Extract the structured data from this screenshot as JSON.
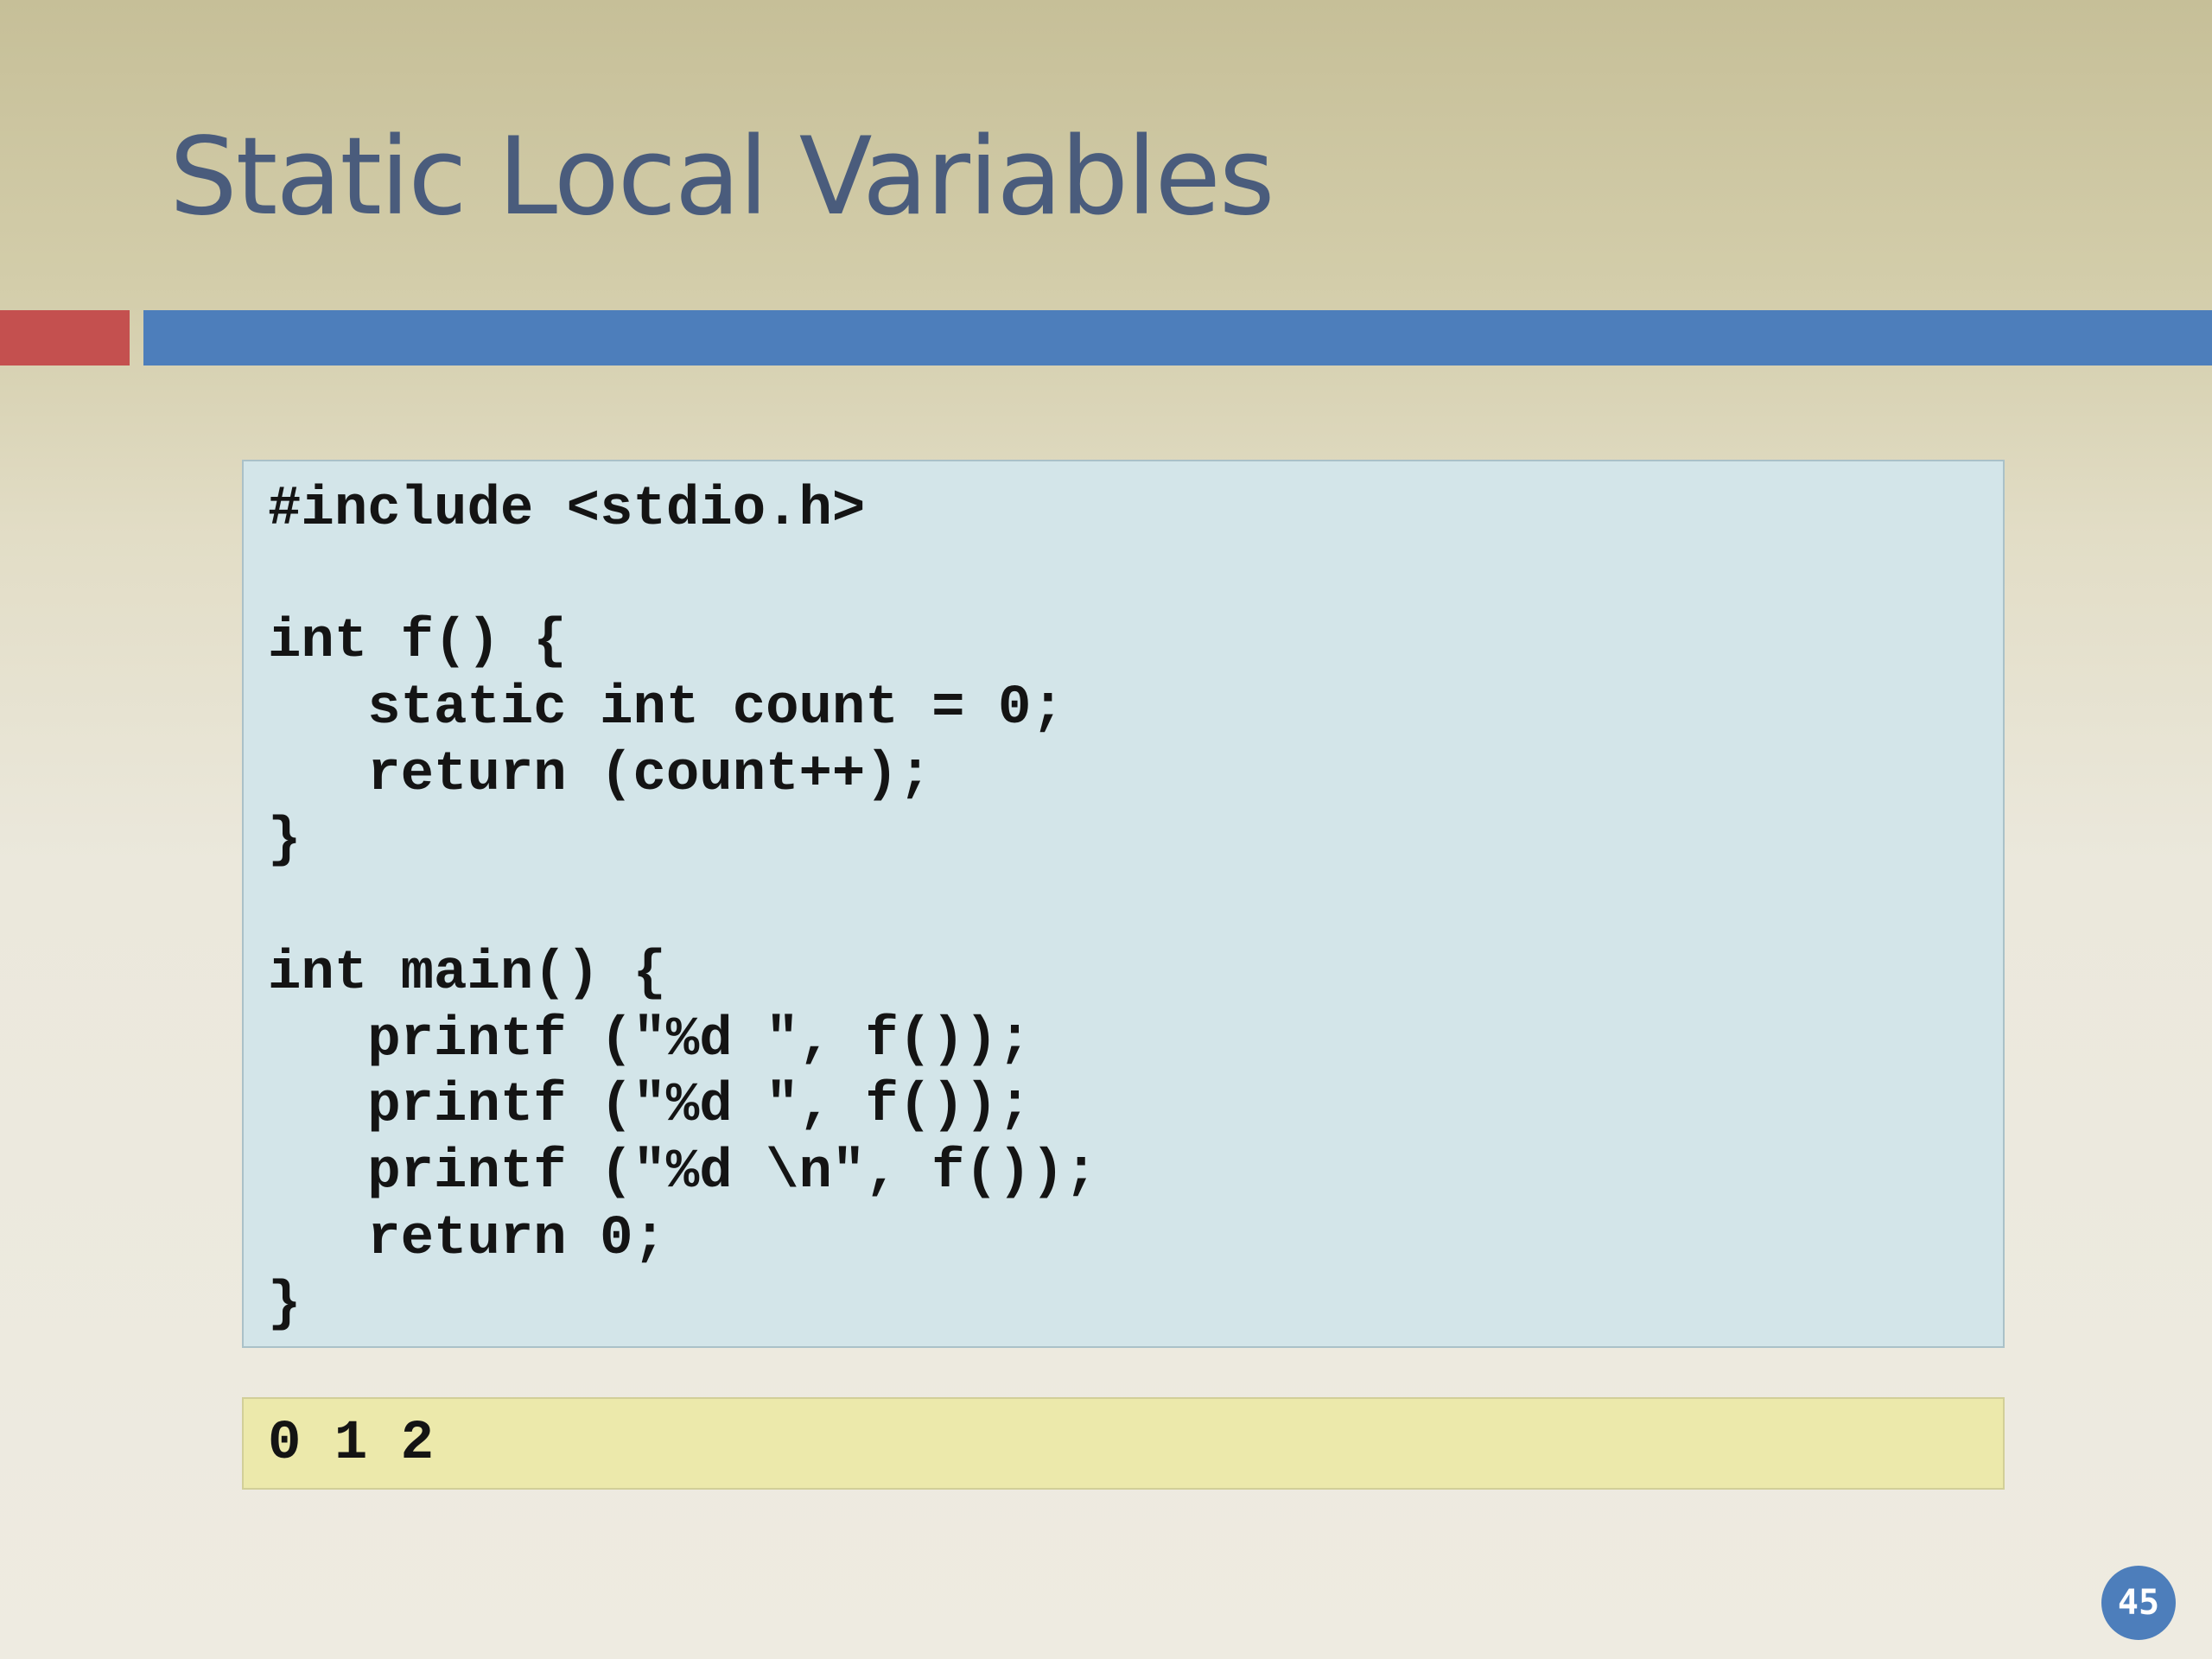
{
  "slide": {
    "title": "Static Local Variables",
    "code_lines": [
      "#include <stdio.h>",
      "",
      "int f() {",
      "   static int count = 0;",
      "   return (count++);",
      "}",
      "",
      "int main() {",
      "   printf (\"%d \", f());",
      "   printf (\"%d \", f());",
      "   printf (\"%d \\n\", f());",
      "   return 0;",
      "}"
    ],
    "output": "0 1 2",
    "page_number": "45"
  },
  "colors": {
    "title": "#4a5c7c",
    "accent_red": "#c4504f",
    "accent_blue": "#4d7ebb",
    "code_background": "#d3e5e9",
    "output_background": "#ece9ab"
  }
}
